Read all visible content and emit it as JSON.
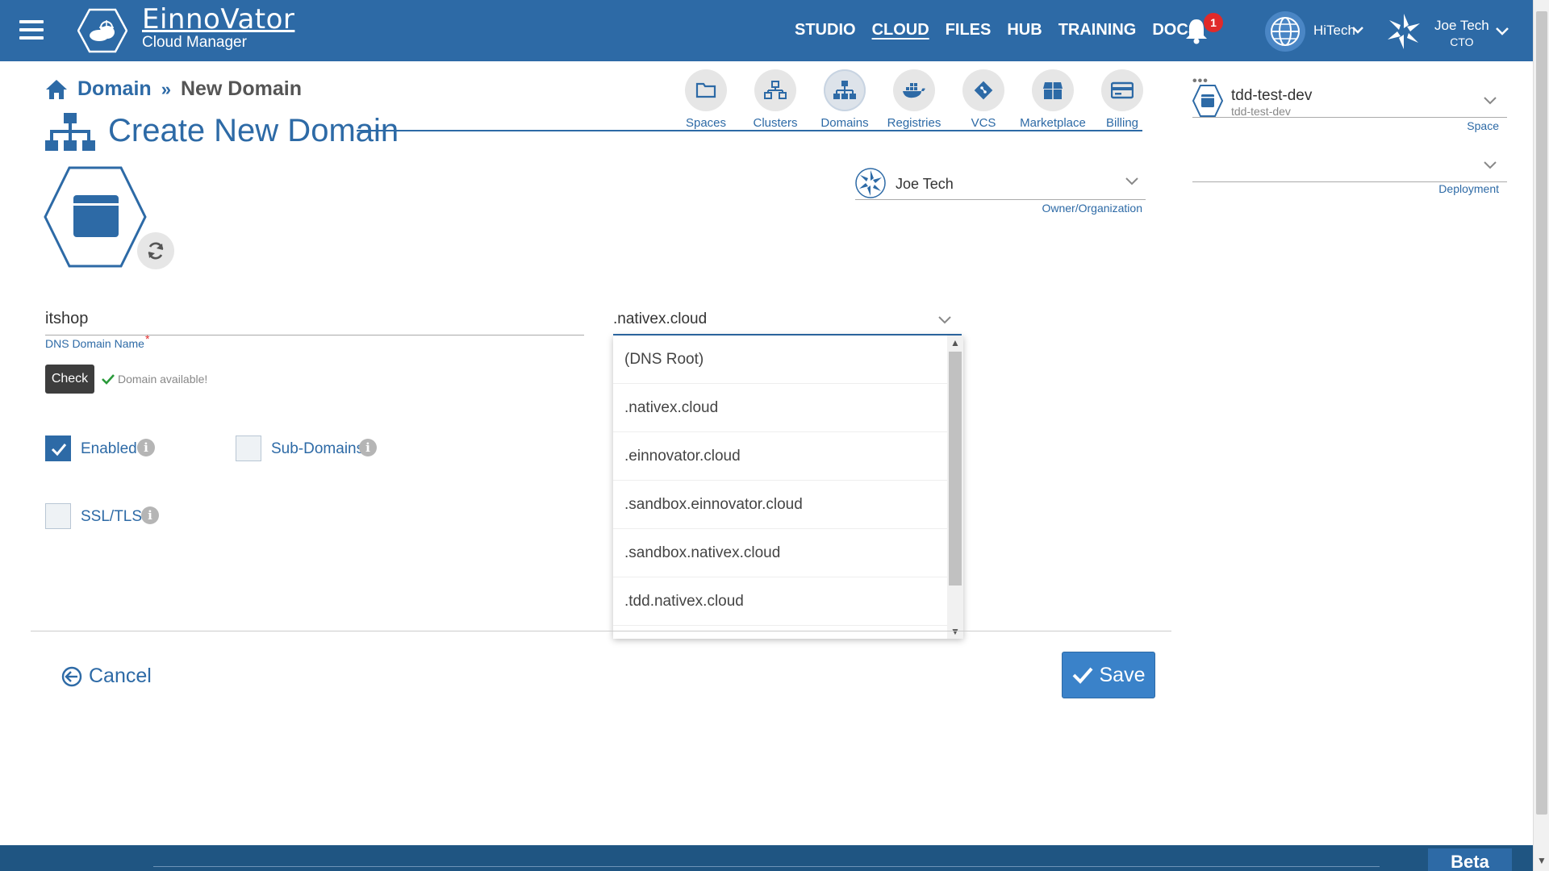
{
  "header": {
    "brand_name": "EinnoVator",
    "brand_sub": "Cloud Manager",
    "nav": [
      "STUDIO",
      "CLOUD",
      "FILES",
      "HUB",
      "TRAINING",
      "DOCS"
    ],
    "active_nav": "CLOUD",
    "notification_count": "1",
    "org_name": "HiTech",
    "user_name": "Joe Tech",
    "user_role": "CTO",
    "colors": {
      "bar": "#2d6aa6",
      "badge": "#e02a2a"
    }
  },
  "breadcrumb": {
    "root": "Domain",
    "separator": "»",
    "current": "New Domain"
  },
  "page_title": "Create New Domain",
  "sections": [
    {
      "label": "Spaces",
      "icon": "folder-icon"
    },
    {
      "label": "Clusters",
      "icon": "clusters-icon"
    },
    {
      "label": "Domains",
      "icon": "domains-icon",
      "active": true
    },
    {
      "label": "Registries",
      "icon": "docker-icon"
    },
    {
      "label": "VCS",
      "icon": "git-icon"
    },
    {
      "label": "Marketplace",
      "icon": "store-icon"
    },
    {
      "label": "Billing",
      "icon": "card-icon"
    }
  ],
  "owner": {
    "name": "Joe Tech",
    "label": "Owner/Organization"
  },
  "sidebar": {
    "dots": "•••",
    "space": {
      "title": "tdd-test-dev",
      "subtitle": "tdd-test-dev",
      "label": "Space"
    },
    "deployment": {
      "label": "Deployment"
    }
  },
  "form": {
    "dns_value": "itshop",
    "dns_label": "DNS Domain Name",
    "required_mark": "*",
    "check_label": "Check",
    "available_text": "Domain available!",
    "enabled_label": "Enabled",
    "enabled_checked": true,
    "subdomains_label": "Sub-Domains",
    "subdomains_checked": false,
    "ssl_label": "SSL/TLS",
    "ssl_checked": false,
    "info_glyph": "i"
  },
  "suffix": {
    "selected": ".nativex.cloud",
    "options": [
      "(DNS Root)",
      ".nativex.cloud",
      ".einnovator.cloud",
      ".sandbox.einnovator.cloud",
      ".sandbox.nativex.cloud",
      ".tdd.nativex.cloud"
    ]
  },
  "actions": {
    "cancel": "Cancel",
    "save": "Save"
  },
  "footer": {
    "beta": "Beta"
  }
}
